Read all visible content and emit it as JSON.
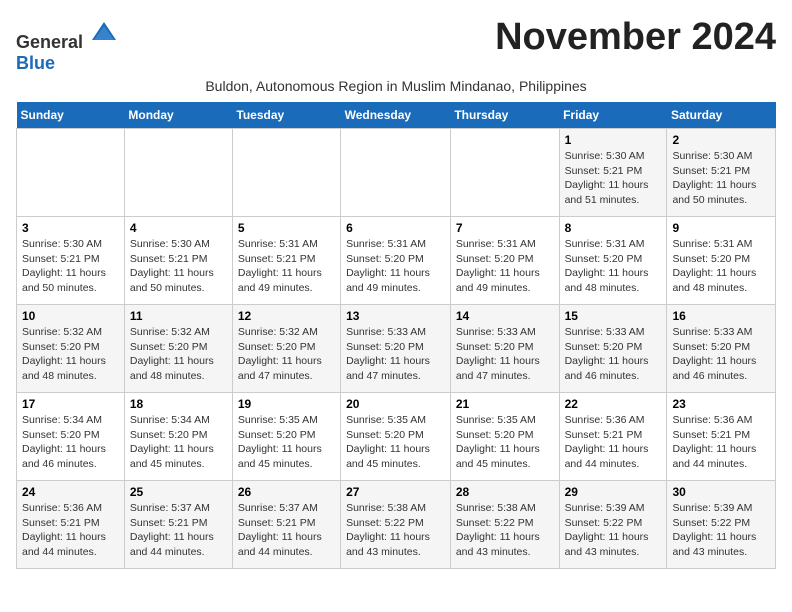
{
  "logo": {
    "general": "General",
    "blue": "Blue"
  },
  "title": "November 2024",
  "subtitle": "Buldon, Autonomous Region in Muslim Mindanao, Philippines",
  "headers": [
    "Sunday",
    "Monday",
    "Tuesday",
    "Wednesday",
    "Thursday",
    "Friday",
    "Saturday"
  ],
  "weeks": [
    [
      {
        "day": "",
        "info": ""
      },
      {
        "day": "",
        "info": ""
      },
      {
        "day": "",
        "info": ""
      },
      {
        "day": "",
        "info": ""
      },
      {
        "day": "",
        "info": ""
      },
      {
        "day": "1",
        "info": "Sunrise: 5:30 AM\nSunset: 5:21 PM\nDaylight: 11 hours and 51 minutes."
      },
      {
        "day": "2",
        "info": "Sunrise: 5:30 AM\nSunset: 5:21 PM\nDaylight: 11 hours and 50 minutes."
      }
    ],
    [
      {
        "day": "3",
        "info": "Sunrise: 5:30 AM\nSunset: 5:21 PM\nDaylight: 11 hours and 50 minutes."
      },
      {
        "day": "4",
        "info": "Sunrise: 5:30 AM\nSunset: 5:21 PM\nDaylight: 11 hours and 50 minutes."
      },
      {
        "day": "5",
        "info": "Sunrise: 5:31 AM\nSunset: 5:21 PM\nDaylight: 11 hours and 49 minutes."
      },
      {
        "day": "6",
        "info": "Sunrise: 5:31 AM\nSunset: 5:20 PM\nDaylight: 11 hours and 49 minutes."
      },
      {
        "day": "7",
        "info": "Sunrise: 5:31 AM\nSunset: 5:20 PM\nDaylight: 11 hours and 49 minutes."
      },
      {
        "day": "8",
        "info": "Sunrise: 5:31 AM\nSunset: 5:20 PM\nDaylight: 11 hours and 48 minutes."
      },
      {
        "day": "9",
        "info": "Sunrise: 5:31 AM\nSunset: 5:20 PM\nDaylight: 11 hours and 48 minutes."
      }
    ],
    [
      {
        "day": "10",
        "info": "Sunrise: 5:32 AM\nSunset: 5:20 PM\nDaylight: 11 hours and 48 minutes."
      },
      {
        "day": "11",
        "info": "Sunrise: 5:32 AM\nSunset: 5:20 PM\nDaylight: 11 hours and 48 minutes."
      },
      {
        "day": "12",
        "info": "Sunrise: 5:32 AM\nSunset: 5:20 PM\nDaylight: 11 hours and 47 minutes."
      },
      {
        "day": "13",
        "info": "Sunrise: 5:33 AM\nSunset: 5:20 PM\nDaylight: 11 hours and 47 minutes."
      },
      {
        "day": "14",
        "info": "Sunrise: 5:33 AM\nSunset: 5:20 PM\nDaylight: 11 hours and 47 minutes."
      },
      {
        "day": "15",
        "info": "Sunrise: 5:33 AM\nSunset: 5:20 PM\nDaylight: 11 hours and 46 minutes."
      },
      {
        "day": "16",
        "info": "Sunrise: 5:33 AM\nSunset: 5:20 PM\nDaylight: 11 hours and 46 minutes."
      }
    ],
    [
      {
        "day": "17",
        "info": "Sunrise: 5:34 AM\nSunset: 5:20 PM\nDaylight: 11 hours and 46 minutes."
      },
      {
        "day": "18",
        "info": "Sunrise: 5:34 AM\nSunset: 5:20 PM\nDaylight: 11 hours and 45 minutes."
      },
      {
        "day": "19",
        "info": "Sunrise: 5:35 AM\nSunset: 5:20 PM\nDaylight: 11 hours and 45 minutes."
      },
      {
        "day": "20",
        "info": "Sunrise: 5:35 AM\nSunset: 5:20 PM\nDaylight: 11 hours and 45 minutes."
      },
      {
        "day": "21",
        "info": "Sunrise: 5:35 AM\nSunset: 5:20 PM\nDaylight: 11 hours and 45 minutes."
      },
      {
        "day": "22",
        "info": "Sunrise: 5:36 AM\nSunset: 5:21 PM\nDaylight: 11 hours and 44 minutes."
      },
      {
        "day": "23",
        "info": "Sunrise: 5:36 AM\nSunset: 5:21 PM\nDaylight: 11 hours and 44 minutes."
      }
    ],
    [
      {
        "day": "24",
        "info": "Sunrise: 5:36 AM\nSunset: 5:21 PM\nDaylight: 11 hours and 44 minutes."
      },
      {
        "day": "25",
        "info": "Sunrise: 5:37 AM\nSunset: 5:21 PM\nDaylight: 11 hours and 44 minutes."
      },
      {
        "day": "26",
        "info": "Sunrise: 5:37 AM\nSunset: 5:21 PM\nDaylight: 11 hours and 44 minutes."
      },
      {
        "day": "27",
        "info": "Sunrise: 5:38 AM\nSunset: 5:22 PM\nDaylight: 11 hours and 43 minutes."
      },
      {
        "day": "28",
        "info": "Sunrise: 5:38 AM\nSunset: 5:22 PM\nDaylight: 11 hours and 43 minutes."
      },
      {
        "day": "29",
        "info": "Sunrise: 5:39 AM\nSunset: 5:22 PM\nDaylight: 11 hours and 43 minutes."
      },
      {
        "day": "30",
        "info": "Sunrise: 5:39 AM\nSunset: 5:22 PM\nDaylight: 11 hours and 43 minutes."
      }
    ]
  ]
}
